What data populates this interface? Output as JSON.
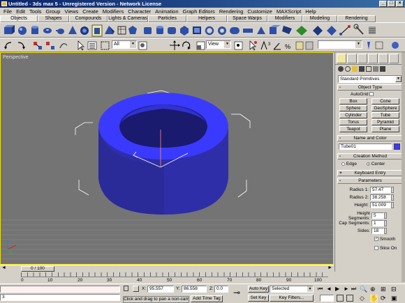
{
  "window": {
    "title": "Untitled - 3ds max 5 - Unregistered Version - Network License"
  },
  "menu": [
    "File",
    "Edit",
    "Tools",
    "Group",
    "Views",
    "Create",
    "Modifiers",
    "Character",
    "Animation",
    "Graph Editors",
    "Rendering",
    "Customize",
    "MAXScript",
    "Help"
  ],
  "tabs": [
    "Objects",
    "Shapes",
    "Compounds",
    "Lights & Cameras",
    "Particles",
    "Helpers",
    "Space Warps",
    "Modifiers",
    "Modeling",
    "Rendering"
  ],
  "toolbar2": {
    "selection_filter": "All",
    "ref_coord": "View"
  },
  "viewport": {
    "label": "Perspective",
    "object_color": "#2e2ea8"
  },
  "panel": {
    "category": "Standard Primitives",
    "object_type": {
      "title": "Object Type",
      "autogrid": "AutoGrid",
      "buttons": [
        "Box",
        "Cone",
        "Sphere",
        "GeoSphere",
        "Cylinder",
        "Tube",
        "Torus",
        "Pyramid",
        "Teapot",
        "Plane"
      ]
    },
    "name_color": {
      "title": "Name and Color",
      "name": "Tube01",
      "swatch": "#3a3aff"
    },
    "creation_method": {
      "title": "Creation Method",
      "edge": "Edge",
      "center": "Center"
    },
    "keyboard_entry": {
      "title": "Keyboard Entry"
    },
    "parameters": {
      "title": "Parameters",
      "radius1_label": "Radius 1:",
      "radius1": "57.47",
      "radius2_label": "Radius 2:",
      "radius2": "38.258",
      "height_label": "Height:",
      "height": "51.009",
      "hseg_label": "Height Segments:",
      "hseg": "5",
      "capseg_label": "Cap Segments:",
      "capseg": "1",
      "sides_label": "Sides:",
      "sides": "18",
      "smooth_label": "Smooth",
      "slice_label": "Slice On"
    }
  },
  "timeline": {
    "slider": "0 / 100",
    "ticks": [
      "0",
      "10",
      "20",
      "30",
      "40",
      "50",
      "60",
      "70",
      "80",
      "90",
      "100"
    ]
  },
  "status": {
    "command_value": "3",
    "x_label": "X:",
    "x": "95.557",
    "y_label": "Y:",
    "y": "86.558",
    "z_label": "Z:",
    "z": "0.0",
    "prompt": "Click and drag to pan a non-camer",
    "add_time_tag": "Add Time Tag",
    "auto_key": "Auto Key",
    "selected": "Selected",
    "set_key": "Set Key",
    "key_filters": "Key Filters..."
  }
}
